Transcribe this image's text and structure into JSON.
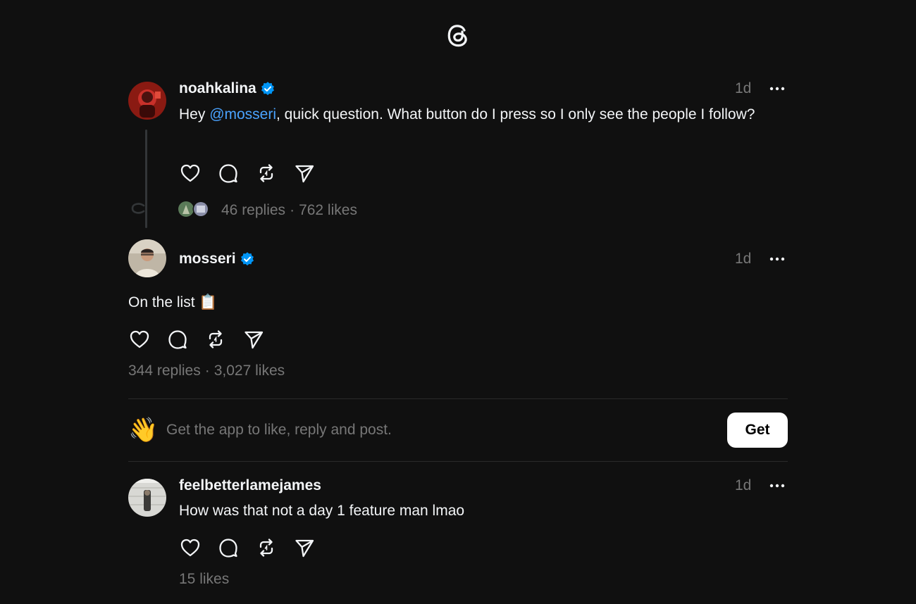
{
  "app": {
    "logo_icon": "threads-logo-icon"
  },
  "posts": [
    {
      "username": "noahkalina",
      "verified": true,
      "time": "1d",
      "text_before": "Hey ",
      "mention": "@mosseri",
      "text_after": ", quick question. What button do I press so I only see the people I follow?",
      "replies": "46 replies",
      "separator": "·",
      "likes": "762 likes"
    },
    {
      "username": "mosseri",
      "verified": true,
      "time": "1d",
      "text": "On the list 📋",
      "replies": "344 replies",
      "separator": "·",
      "likes": "3,027 likes"
    },
    {
      "username": "feelbetterlamejames",
      "verified": false,
      "time": "1d",
      "text": "How was that not a day 1 feature man lmao",
      "likes": "15 likes"
    }
  ],
  "cta": {
    "emoji": "👋",
    "text": "Get the app to like, reply and post.",
    "button_label": "Get"
  },
  "colors": {
    "background": "#101010",
    "text": "#f3f5f7",
    "muted": "#777777",
    "mention": "#4aa3ff",
    "verified": "#0095f6"
  }
}
